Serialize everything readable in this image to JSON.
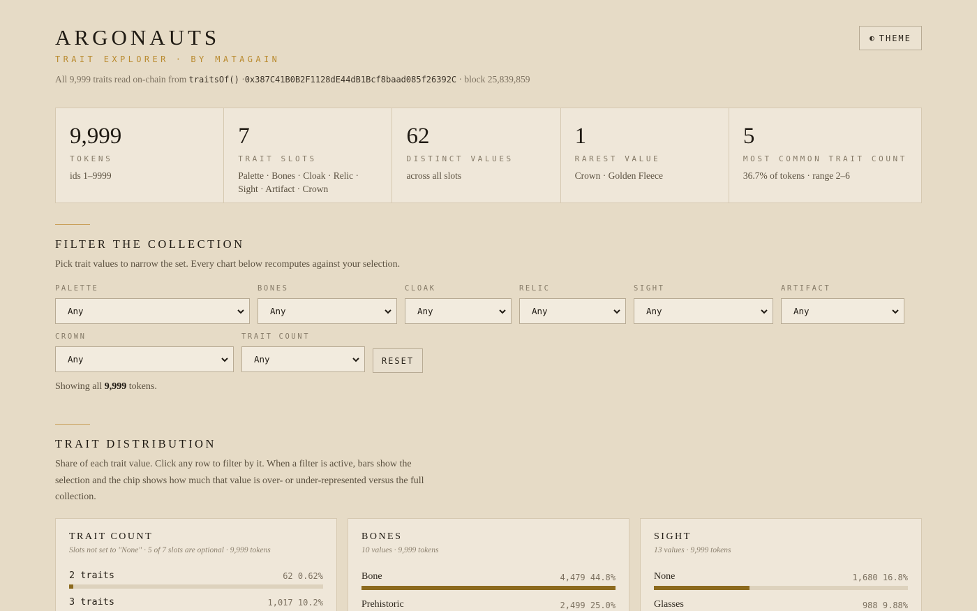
{
  "header": {
    "title": "ARGONAUTS",
    "subtitle_left": "TRAIT EXPLORER",
    "subtitle_dot": "·",
    "subtitle_right": "BY MATAGAIN",
    "provenance_prefix": "All 9,999 traits read on-chain from",
    "provenance_fn": "traitsOf()",
    "provenance_sep1": "·",
    "provenance_address": "0x387C41B0B2F1128dE44dB1Bcf8baad085f26392C",
    "provenance_block": "· block 25,839,859",
    "theme_icon": "◐",
    "theme_label": "THEME"
  },
  "stats": [
    {
      "value": "9,999",
      "label": "TOKENS",
      "desc": "ids 1–9999"
    },
    {
      "value": "7",
      "label": "TRAIT SLOTS",
      "desc": "Palette · Bones · Cloak · Relic · Sight · Artifact · Crown"
    },
    {
      "value": "62",
      "label": "DISTINCT VALUES",
      "desc": "across all slots"
    },
    {
      "value": "1",
      "label": "RAREST VALUE",
      "desc": "Crown · Golden Fleece"
    },
    {
      "value": "5",
      "label": "MOST COMMON TRAIT COUNT",
      "desc": "36.7% of tokens · range 2–6"
    }
  ],
  "filter_section": {
    "title": "FILTER THE COLLECTION",
    "desc": "Pick trait values to narrow the set. Every chart below recomputes against your selection.",
    "filters": [
      {
        "label": "PALETTE",
        "value": "Any"
      },
      {
        "label": "BONES",
        "value": "Any"
      },
      {
        "label": "CLOAK",
        "value": "Any"
      },
      {
        "label": "RELIC",
        "value": "Any"
      },
      {
        "label": "SIGHT",
        "value": "Any"
      },
      {
        "label": "ARTIFACT",
        "value": "Any"
      },
      {
        "label": "CROWN",
        "value": "Any"
      },
      {
        "label": "TRAIT COUNT",
        "value": "Any"
      }
    ],
    "reset_label": "RESET",
    "showing_prefix": "Showing all",
    "showing_count": "9,999",
    "showing_suffix": "tokens."
  },
  "distribution_section": {
    "title": "TRAIT DISTRIBUTION",
    "desc": "Share of each trait value. Click any row to filter by it. When a filter is active, bars show the selection and the chip shows how much that value is over- or under-represented versus the full collection."
  },
  "cards": [
    {
      "title": "TRAIT COUNT",
      "sub": "Slots not set to \"None\" · 5 of 7 slots are optional · 9,999 tokens",
      "rows": [
        {
          "label": "2 traits",
          "count": "62",
          "pct": "0.62%",
          "share": 0.0062
        },
        {
          "label": "3 traits",
          "count": "1,017",
          "pct": "10.2%",
          "share": 0.102
        }
      ]
    },
    {
      "title": "BONES",
      "sub": "10 values · 9,999 tokens",
      "rows": [
        {
          "label": "Bone",
          "count": "4,479",
          "pct": "44.8%",
          "share": 0.448
        },
        {
          "label": "Prehistoric",
          "count": "2,499",
          "pct": "25.0%",
          "share": 0.25
        }
      ]
    },
    {
      "title": "SIGHT",
      "sub": "13 values · 9,999 tokens",
      "rows": [
        {
          "label": "None",
          "count": "1,680",
          "pct": "16.8%",
          "share": 0.168
        },
        {
          "label": "Glasses",
          "count": "988",
          "pct": "9.88%",
          "share": 0.0988
        }
      ]
    }
  ]
}
